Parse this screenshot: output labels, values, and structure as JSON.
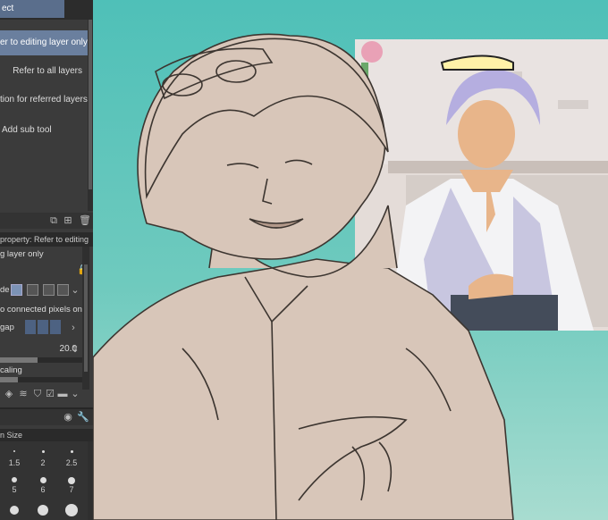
{
  "subtool_panel": {
    "tab_label": "ect",
    "items": [
      {
        "label": "er to editing layer only",
        "selected": true
      },
      {
        "label": "Refer to all layers",
        "selected": false
      },
      {
        "label": "tion for referred layers",
        "selected": false
      },
      {
        "label": "Add sub tool",
        "selected": false
      }
    ]
  },
  "tool_property": {
    "header": "property: Refer to editing",
    "subtitle": "g layer only",
    "mode_label": "de",
    "connected_pixels_label": "o connected pixels only",
    "gap_label": "gap",
    "value": "20.0",
    "scaling_label": "caling"
  },
  "brush_size": {
    "header": "n Size",
    "sizes": [
      "1.5",
      "2",
      "2.5",
      "5",
      "6",
      "7"
    ]
  },
  "colors": {
    "canvas_bg": "#4fc0b8",
    "selected_item": "#6a7f9e",
    "panel_bg": "#3b3b3b"
  }
}
